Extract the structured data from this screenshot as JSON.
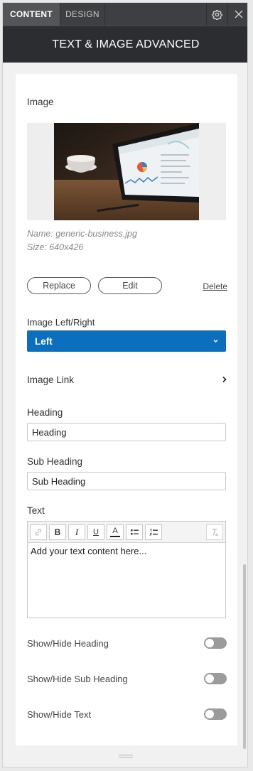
{
  "tabs": {
    "content": "CONTENT",
    "design": "DESIGN"
  },
  "panel_title": "TEXT & IMAGE ADVANCED",
  "image_section": {
    "label": "Image",
    "name_line": "Name: generic-business.jpg",
    "size_line": "Size: 640x426"
  },
  "buttons": {
    "replace": "Replace",
    "edit": "Edit",
    "delete": "Delete"
  },
  "image_position": {
    "label": "Image Left/Right",
    "value": "Left"
  },
  "image_link": {
    "label": "Image Link"
  },
  "heading": {
    "label": "Heading",
    "value": "Heading"
  },
  "sub_heading": {
    "label": "Sub Heading",
    "value": "Sub Heading"
  },
  "text": {
    "label": "Text",
    "content": "Add your text content here..."
  },
  "editor_toolbar": {
    "bold": "B",
    "italic": "I",
    "underline": "U",
    "font_color": "A"
  },
  "toggles": [
    {
      "label": "Show/Hide Heading",
      "on": false
    },
    {
      "label": "Show/Hide Sub Heading",
      "on": false
    },
    {
      "label": "Show/Hide Text",
      "on": false
    }
  ],
  "colors": {
    "accent": "#0b6fbd",
    "header": "#2b2d30",
    "tab_active": "#535559"
  }
}
